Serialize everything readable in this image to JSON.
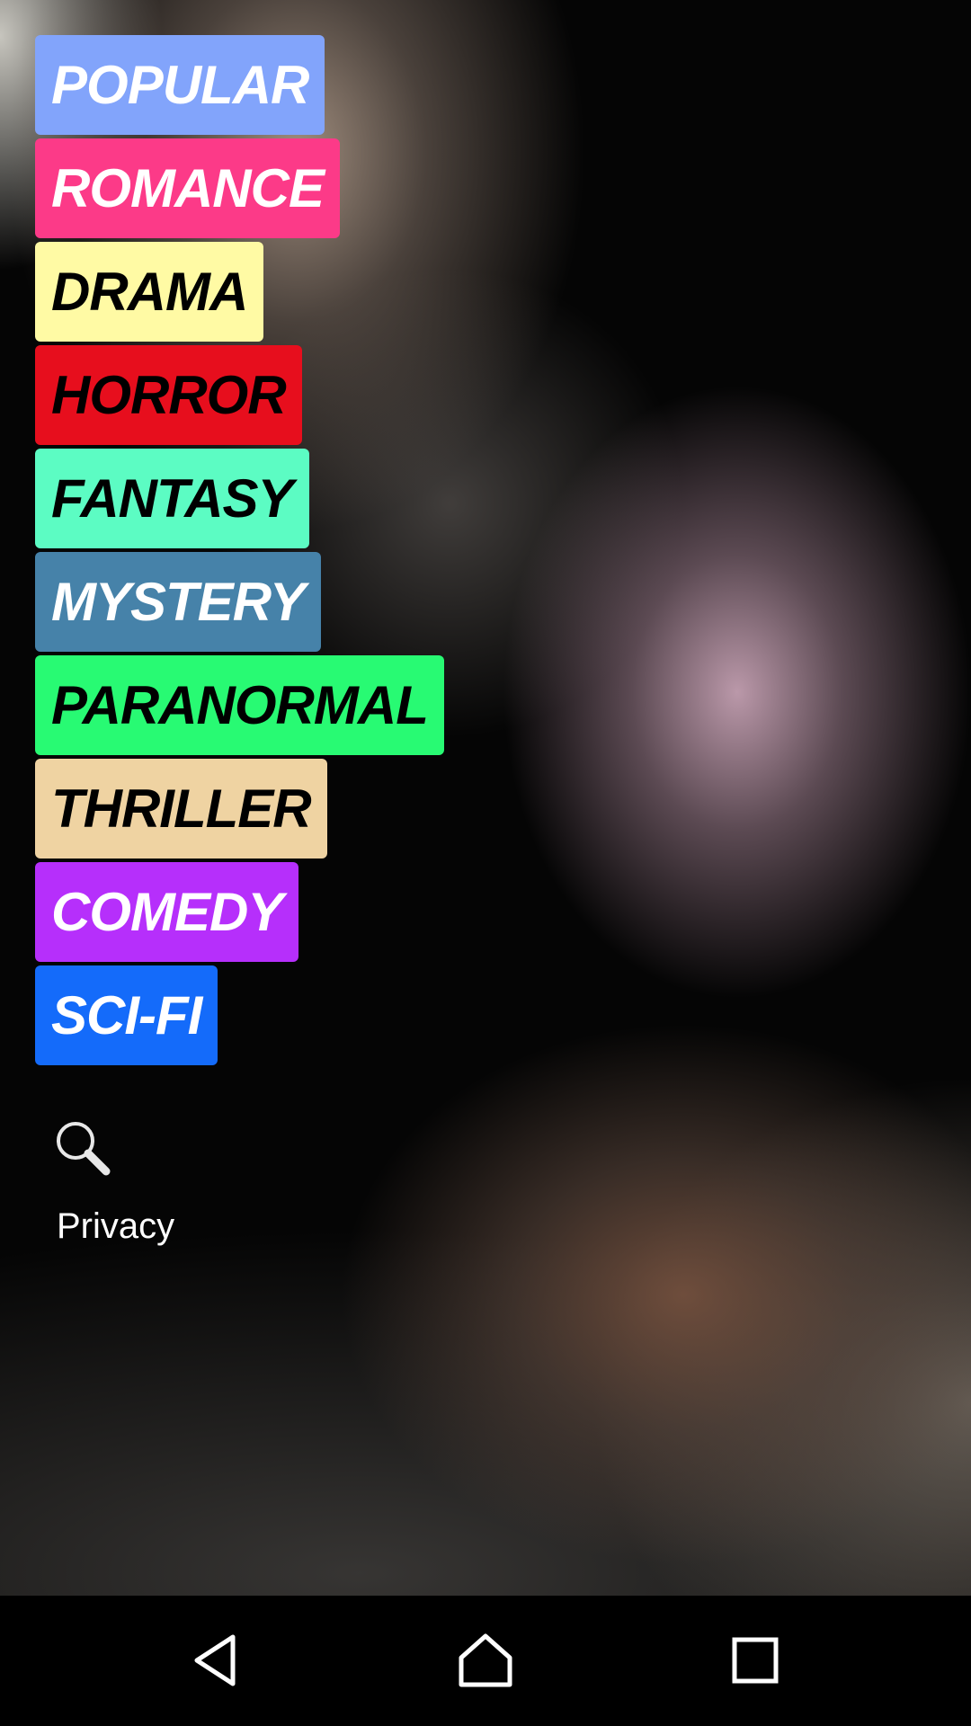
{
  "genres": [
    {
      "label": "POPULAR",
      "bg": "#82a4fb",
      "fg": "#ffffff"
    },
    {
      "label": "ROMANCE",
      "bg": "#fc3a88",
      "fg": "#ffffff"
    },
    {
      "label": "DRAMA",
      "bg": "#fffaa4",
      "fg": "#000000"
    },
    {
      "label": "HORROR",
      "bg": "#e70e1d",
      "fg": "#000000"
    },
    {
      "label": "FANTASY",
      "bg": "#5cfcc3",
      "fg": "#000000"
    },
    {
      "label": "MYSTERY",
      "bg": "#4682a9",
      "fg": "#ffffff"
    },
    {
      "label": "PARANORMAL",
      "bg": "#28fa73",
      "fg": "#000000"
    },
    {
      "label": "THRILLER",
      "bg": "#efd3a2",
      "fg": "#000000"
    },
    {
      "label": "COMEDY",
      "bg": "#b62ffb",
      "fg": "#ffffff"
    },
    {
      "label": "SCI-FI",
      "bg": "#146bfa",
      "fg": "#ffffff"
    }
  ],
  "search": {
    "icon": "search-icon"
  },
  "privacy": {
    "label": "Privacy"
  },
  "navbar": {
    "back_icon": "back-icon",
    "home_icon": "home-icon",
    "recents_icon": "recents-icon"
  }
}
